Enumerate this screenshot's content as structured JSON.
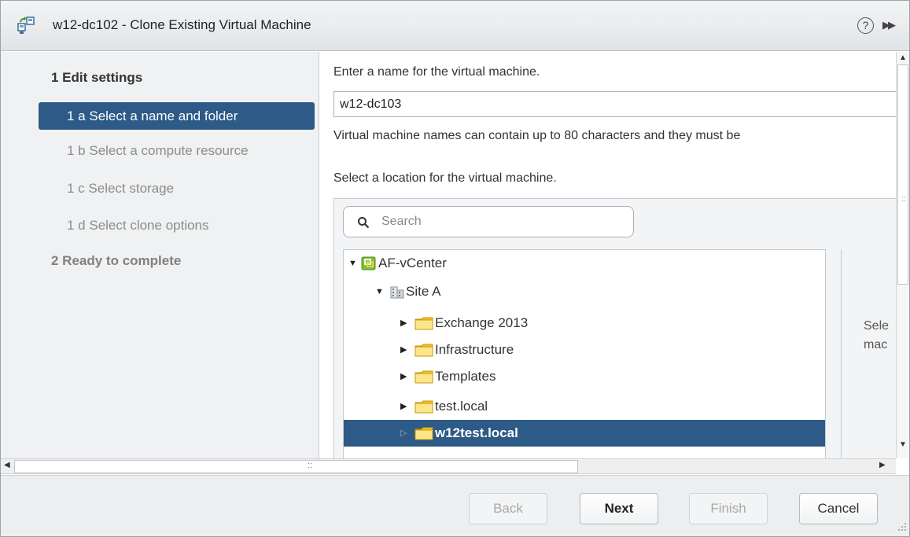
{
  "window": {
    "title": "w12-dc102 - Clone Existing Virtual Machine",
    "help_glyph": "?",
    "expand_glyph": "▶▶"
  },
  "nav": {
    "step1": "1  Edit settings",
    "sub_items": [
      {
        "label": "1 a  Select a name and folder",
        "active": true
      },
      {
        "label": "1 b  Select a compute resource",
        "active": false
      },
      {
        "label": "1 c  Select storage",
        "active": false
      },
      {
        "label": "1 d  Select clone options",
        "active": false
      }
    ],
    "step2": "2  Ready to complete"
  },
  "form": {
    "name_prompt": "Enter a name for the virtual machine.",
    "vm_name": "w12-dc103",
    "name_hint": "Virtual machine names can contain up to 80 characters and they must be",
    "location_prompt": "Select a location for the virtual machine.",
    "search_placeholder": "Search",
    "side_hint_line1": "Sele",
    "side_hint_line2": "mac"
  },
  "tree": {
    "nodes": [
      {
        "label": "AF-vCenter",
        "icon": "vcenter-icon",
        "expanded": true,
        "level": 0
      },
      {
        "label": "Site A",
        "icon": "datacenter-icon",
        "expanded": true,
        "level": 1
      },
      {
        "label": "Exchange 2013",
        "icon": "folder-icon",
        "expanded": false,
        "level": 2
      },
      {
        "label": "Infrastructure",
        "icon": "folder-icon",
        "expanded": false,
        "level": 2
      },
      {
        "label": "Templates",
        "icon": "folder-icon",
        "expanded": false,
        "level": 2
      },
      {
        "label": "test.local",
        "icon": "folder-icon",
        "expanded": false,
        "level": 2
      },
      {
        "label": "w12test.local",
        "icon": "folder-icon",
        "expanded": false,
        "level": 2,
        "selected": true
      }
    ]
  },
  "buttons": {
    "back": "Back",
    "next": "Next",
    "finish": "Finish",
    "cancel": "Cancel"
  },
  "colors": {
    "selection": "#2d5a87",
    "folder": "#f5c518",
    "nav_bg": "#f0f1f2"
  }
}
